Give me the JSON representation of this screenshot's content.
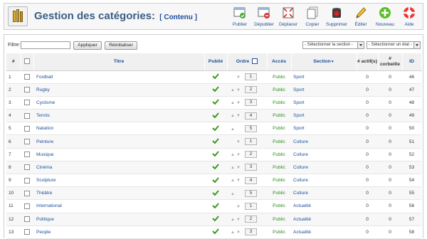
{
  "header": {
    "title": "Gestion des catégories:",
    "subtitle": "[ Contenu ]"
  },
  "toolbar": [
    {
      "key": "publish",
      "label": "Publier",
      "icon": "publish-icon"
    },
    {
      "key": "unpublish",
      "label": "Dépublier",
      "icon": "unpublish-icon"
    },
    {
      "key": "move",
      "label": "Déplacer",
      "icon": "move-icon"
    },
    {
      "key": "copy",
      "label": "Copier",
      "icon": "copy-icon"
    },
    {
      "key": "delete",
      "label": "Supprimer",
      "icon": "trash-icon"
    },
    {
      "key": "edit",
      "label": "Éditer",
      "icon": "pencil-icon"
    },
    {
      "key": "new",
      "label": "Nouveau",
      "icon": "plus-icon"
    },
    {
      "key": "help",
      "label": "Aide",
      "icon": "lifebuoy-icon"
    }
  ],
  "filter": {
    "label": "Filtre:",
    "value": "",
    "apply_label": "Appliquer",
    "reset_label": "Réinitialiser",
    "section_select": "- Sélectionner la section -",
    "state_select": "- Sélectionner un état -"
  },
  "table": {
    "headers": {
      "num": "#",
      "title": "Titre",
      "published": "Publié",
      "order": "Ordre",
      "access": "Accès",
      "section": "Section",
      "active": "# actif(s)",
      "trash": "# corbeille",
      "id": "ID"
    },
    "rows": [
      {
        "num": "1",
        "title": "Football",
        "order": "1",
        "access": "Public",
        "section": "Sport",
        "active": "0",
        "trash": "0",
        "id": "46",
        "up": false,
        "down": true
      },
      {
        "num": "2",
        "title": "Rugby",
        "order": "2",
        "access": "Public",
        "section": "Sport",
        "active": "0",
        "trash": "0",
        "id": "47",
        "up": true,
        "down": true
      },
      {
        "num": "3",
        "title": "Cyclisme",
        "order": "3",
        "access": "Public",
        "section": "Sport",
        "active": "0",
        "trash": "0",
        "id": "48",
        "up": true,
        "down": true
      },
      {
        "num": "4",
        "title": "Tennis",
        "order": "4",
        "access": "Public",
        "section": "Sport",
        "active": "0",
        "trash": "0",
        "id": "49",
        "up": true,
        "down": true
      },
      {
        "num": "5",
        "title": "Natation",
        "order": "5",
        "access": "Public",
        "section": "Sport",
        "active": "0",
        "trash": "0",
        "id": "50",
        "up": true,
        "down": false
      },
      {
        "num": "6",
        "title": "Peinture",
        "order": "1",
        "access": "Public",
        "section": "Culture",
        "active": "0",
        "trash": "0",
        "id": "51",
        "up": false,
        "down": true
      },
      {
        "num": "7",
        "title": "Musique",
        "order": "2",
        "access": "Public",
        "section": "Culture",
        "active": "0",
        "trash": "0",
        "id": "52",
        "up": true,
        "down": true
      },
      {
        "num": "8",
        "title": "Cinéma",
        "order": "3",
        "access": "Public",
        "section": "Culture",
        "active": "0",
        "trash": "0",
        "id": "53",
        "up": true,
        "down": true
      },
      {
        "num": "9",
        "title": "Sculpture",
        "order": "4",
        "access": "Public",
        "section": "Culture",
        "active": "0",
        "trash": "0",
        "id": "54",
        "up": true,
        "down": true
      },
      {
        "num": "10",
        "title": "Théâtre",
        "order": "5",
        "access": "Public",
        "section": "Culture",
        "active": "0",
        "trash": "0",
        "id": "55",
        "up": true,
        "down": false
      },
      {
        "num": "11",
        "title": "International",
        "order": "1",
        "access": "Public",
        "section": "Actualité",
        "active": "0",
        "trash": "0",
        "id": "56",
        "up": false,
        "down": true
      },
      {
        "num": "12",
        "title": "Politique",
        "order": "2",
        "access": "Public",
        "section": "Actualité",
        "active": "0",
        "trash": "0",
        "id": "57",
        "up": true,
        "down": true
      },
      {
        "num": "13",
        "title": "People",
        "order": "3",
        "access": "Public",
        "section": "Actualité",
        "active": "0",
        "trash": "0",
        "id": "58",
        "up": true,
        "down": true
      }
    ]
  },
  "colors": {
    "link": "#1d4e9e",
    "access_public": "#2c8e1c",
    "published_tick": "#3c9a1e"
  }
}
